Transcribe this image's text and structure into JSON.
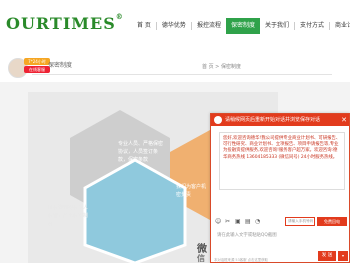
{
  "header": {
    "logo": "OURTIMES",
    "logo_mark": "®"
  },
  "nav": {
    "items": [
      "首 页",
      "德华优势",
      "报控流程",
      "保密制度",
      "关于我们",
      "支付方式",
      "商业计划书"
    ],
    "active_index": 3
  },
  "agent_badge": {
    "line1": "7*24小时",
    "line2": "在线客服"
  },
  "page": {
    "title_small": "保密制度",
    "breadcrumb": "首 页 > 保密制度",
    "bottom_title": "微",
    "bottom_title2": "信"
  },
  "hex_texts": {
    "left_top": "专业人员、严格保密协议，人员签订条款，保密条款",
    "left_bottom": "所有资料均有专人保管，严格保密制度",
    "right": "我们为客户机密负责"
  },
  "chat": {
    "header_text": "请稍候网页后重新开始对话并浏览保存对话",
    "close": "✕",
    "message": "您好,欢迎咨询德华!我公司提供专业商业计划书、可研报告、可行性研究、商业计划书、立项报告、项目申请报告等,专业为投融资提供服务,欢迎咨询!服务客户超万家。欢迎咨询:德华商务热线 13604185333 (微信同号) 24小时服务热线。",
    "phone_placeholder": "请输入手机号码",
    "call_button": "免费回电",
    "input_placeholder": "请在此输入文字或粘贴QQ截图",
    "send_button": "发 送",
    "send_arrow": "▾",
    "footer_note": "本对话框来源 53客服 点击这里获取"
  },
  "colors": {
    "brand_green": "#2a8a2a",
    "nav_active": "#2fa24a",
    "chat_red": "#e23b1d",
    "hex_blue": "#8fc9dd",
    "hex_orange": "#f0b070"
  }
}
